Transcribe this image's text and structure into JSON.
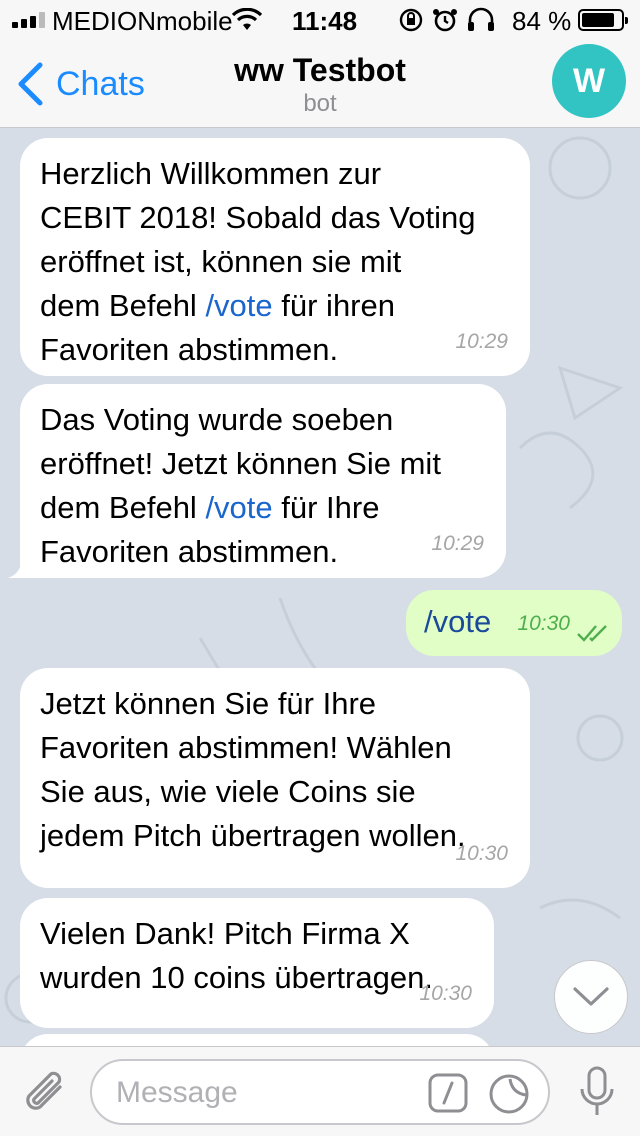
{
  "status_bar": {
    "carrier": "MEDIONmobile",
    "time": "11:48",
    "battery_percent": "84 %",
    "battery_level": 0.84
  },
  "nav": {
    "back_label": "Chats",
    "title": "ww Testbot",
    "subtitle": "bot",
    "avatar_letter": "W",
    "avatar_color": "#32c3c3"
  },
  "messages": [
    {
      "direction": "in",
      "parts": [
        "Herzlich Willkommen zur\nCEBIT 2018! Sobald das Voting\neröffnet ist, können sie mit\ndem Befehl ",
        "/vote",
        " für ihren\nFavoriten abstimmen."
      ],
      "time": "10:29"
    },
    {
      "direction": "in",
      "parts": [
        "Das Voting wurde soeben\neröffnet! Jetzt können Sie mit\ndem Befehl ",
        "/vote",
        " für Ihre\nFavoriten abstimmen."
      ],
      "time": "10:29"
    },
    {
      "direction": "out",
      "text": "/vote",
      "time": "10:30",
      "status": "read"
    },
    {
      "direction": "in",
      "text": "Jetzt können Sie für Ihre\nFavoriten abstimmen! Wählen\nSie aus, wie viele Coins sie\njedem Pitch übertragen wollen.",
      "time": "10:30"
    },
    {
      "direction": "in",
      "text": "Vielen Dank! Pitch Firma X\nwurden 10 coins übertragen.",
      "time": "10:30"
    }
  ],
  "input": {
    "placeholder": "Message"
  },
  "colors": {
    "accent": "#1a8cff",
    "link": "#1a66cc",
    "outgoing_bubble": "#e1fec6",
    "chat_background": "#d6dde6"
  },
  "icons": [
    "back-chevron-icon",
    "attach-paperclip-icon",
    "bot-command-icon",
    "sticker-icon",
    "microphone-icon",
    "scroll-down-chevron-icon",
    "read-checkmarks-icon"
  ]
}
